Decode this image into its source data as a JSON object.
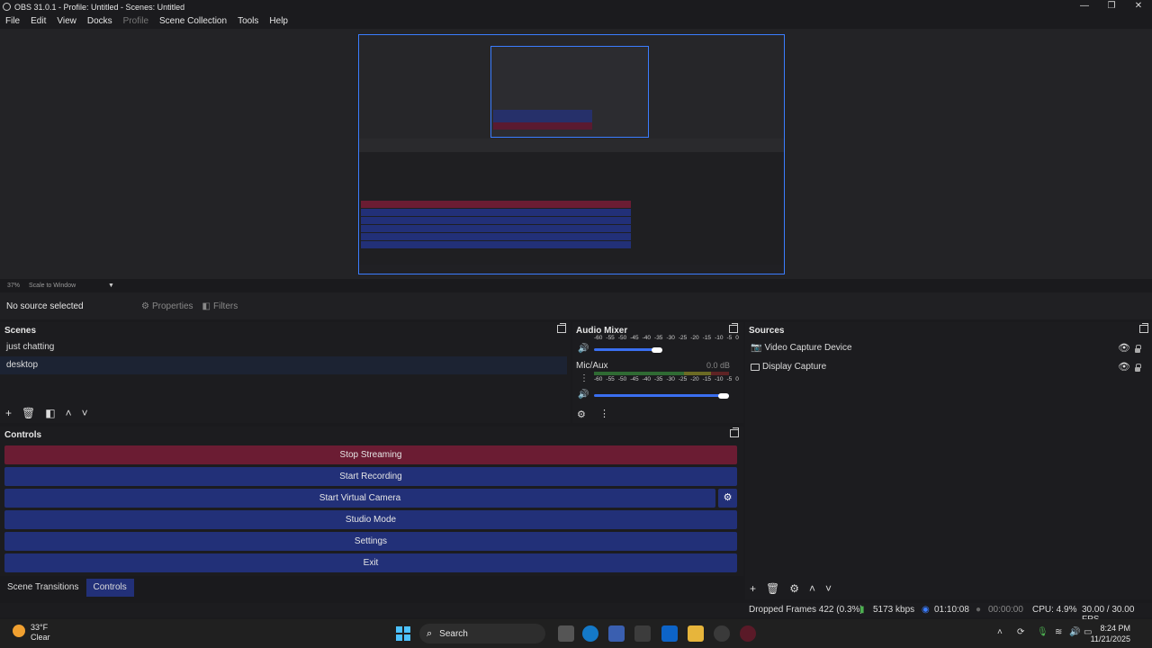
{
  "window": {
    "title": "OBS 31.0.1 - Profile: Untitled - Scenes: Untitled",
    "controls": [
      "—",
      "❐",
      "✕"
    ]
  },
  "menu": [
    {
      "label": "File"
    },
    {
      "label": "Edit"
    },
    {
      "label": "View"
    },
    {
      "label": "Docks"
    },
    {
      "label": "Profile",
      "disabled": true
    },
    {
      "label": "Scene Collection"
    },
    {
      "label": "Tools"
    },
    {
      "label": "Help"
    }
  ],
  "preview": {
    "zoom": "37%",
    "scale_mode": "Scale to Window"
  },
  "source_toolbar": {
    "no_source": "No source selected",
    "properties": "Properties",
    "filters": "Filters"
  },
  "scenes": {
    "title": "Scenes",
    "items": [
      {
        "label": "just chatting"
      },
      {
        "label": "desktop",
        "selected": true
      }
    ]
  },
  "audio_mixer": {
    "title": "Audio Mixer",
    "scale": [
      "-60",
      "-55",
      "-50",
      "-45",
      "-40",
      "-35",
      "-30",
      "-25",
      "-20",
      "-15",
      "-10",
      "-5",
      "0"
    ],
    "channels": [
      {
        "name": "",
        "level": "",
        "volume_fraction": 0.8
      },
      {
        "name": "Mic/Aux",
        "level": "0.0 dB",
        "volume_fraction": 1.0
      }
    ]
  },
  "sources": {
    "title": "Sources",
    "items": [
      {
        "label": "Video Capture Device",
        "icon": "camera-icon"
      },
      {
        "label": "Display Capture",
        "icon": "monitor-icon"
      }
    ]
  },
  "controls": {
    "title": "Controls",
    "stop_streaming": "Stop Streaming",
    "start_recording": "Start Recording",
    "start_virtual_camera": "Start Virtual Camera",
    "studio_mode": "Studio Mode",
    "settings": "Settings",
    "exit": "Exit"
  },
  "bottom_tabs": [
    {
      "label": "Scene Transitions"
    },
    {
      "label": "Controls",
      "active": true
    }
  ],
  "status": {
    "dropped_frames": "Dropped Frames 422 (0.3%)",
    "bitrate": "5173 kbps",
    "stream_time": "01:10:08",
    "record_time": "00:00:00",
    "cpu": "CPU: 4.9%",
    "fps": "30.00 / 30.00 FPS"
  },
  "taskbar": {
    "weather_temp": "33°F",
    "weather_desc": "Clear",
    "search": "Search",
    "time": "8:24 PM",
    "date": "11/21/2025",
    "colors": {
      "accent": "#3b7dff",
      "stream": "#6b1c33",
      "button": "#223078"
    }
  }
}
